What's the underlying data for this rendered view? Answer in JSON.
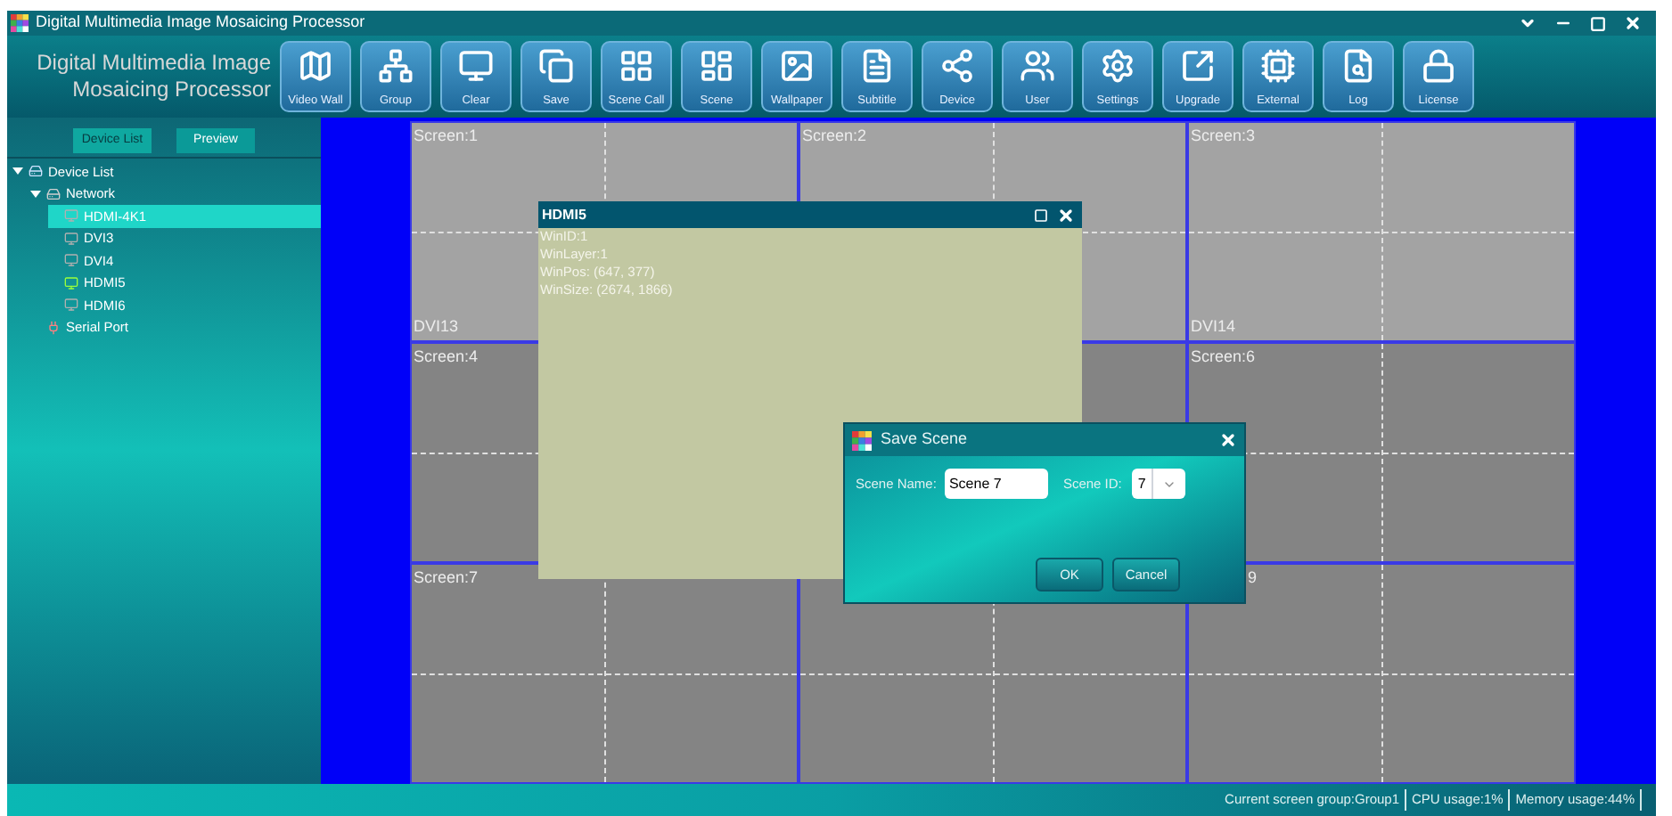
{
  "window": {
    "title": "Digital Multimedia Image Mosaicing Processor"
  },
  "brand": [
    "Digital Multimedia Image",
    "Mosaicing Processor"
  ],
  "toolbar": [
    {
      "label": "Video Wall",
      "kind": "videowall"
    },
    {
      "label": "Group",
      "kind": "group"
    },
    {
      "label": "Clear",
      "kind": "clear"
    },
    {
      "label": "Save",
      "kind": "save"
    },
    {
      "label": "Scene Call",
      "kind": "scenecall"
    },
    {
      "label": "Scene",
      "kind": "scene"
    },
    {
      "label": "Wallpaper",
      "kind": "wallpaper"
    },
    {
      "label": "Subtitle",
      "kind": "subtitle"
    },
    {
      "label": "Device",
      "kind": "device"
    },
    {
      "label": "User",
      "kind": "user"
    },
    {
      "label": "Settings",
      "kind": "settings"
    },
    {
      "label": "Upgrade",
      "kind": "upgrade"
    },
    {
      "label": "External",
      "kind": "external"
    },
    {
      "label": "Log",
      "kind": "log"
    },
    {
      "label": "License",
      "kind": "license"
    }
  ],
  "side_tabs": [
    {
      "label": "Device List",
      "selected": true
    },
    {
      "label": "Preview",
      "selected": false
    }
  ],
  "tree": [
    {
      "label": "Device List",
      "kind": "root",
      "expanded": true,
      "children": [
        {
          "label": "Network",
          "kind": "network",
          "expanded": true,
          "children": [
            {
              "label": "HDMI-4K1",
              "kind": "input",
              "selected": true,
              "active": false
            },
            {
              "label": "DVI3",
              "kind": "input",
              "selected": false,
              "active": false
            },
            {
              "label": "DVI4",
              "kind": "input",
              "selected": false,
              "active": false
            },
            {
              "label": "HDMI5",
              "kind": "input",
              "selected": false,
              "active": true
            },
            {
              "label": "HDMI6",
              "kind": "input",
              "selected": false,
              "active": false
            }
          ]
        },
        {
          "label": "Serial Port",
          "kind": "serial"
        }
      ]
    }
  ],
  "screens": [
    {
      "label": "Screen:1",
      "source": "DVI13",
      "highlighted": true
    },
    {
      "label": "Screen:2",
      "highlighted": true
    },
    {
      "label": "Screen:3",
      "source": "DVI14",
      "highlighted": true
    },
    {
      "label": "Screen:4",
      "highlighted": false
    },
    {
      "highlighted": false
    },
    {
      "label": "Screen:6",
      "highlighted": false
    },
    {
      "label": "Screen:7",
      "highlighted": false
    },
    {
      "highlighted": false
    },
    {
      "label": "9",
      "label_clipped": true,
      "highlighted": false
    }
  ],
  "source_window": {
    "title": "HDMI5",
    "lines": [
      "WinID:1",
      "WinLayer:1",
      "WinPos: (647, 377)",
      "WinSize: (2674, 1866)"
    ]
  },
  "dialog": {
    "title": "Save Scene",
    "name_label": "Scene Name:",
    "name_value": "Scene 7",
    "id_label": "Scene ID:",
    "id_value": "7",
    "buttons": [
      "OK",
      "Cancel"
    ]
  },
  "status_bar": [
    "Current screen group:Group1",
    "CPU usage:1%",
    "Memory usage:44%"
  ]
}
